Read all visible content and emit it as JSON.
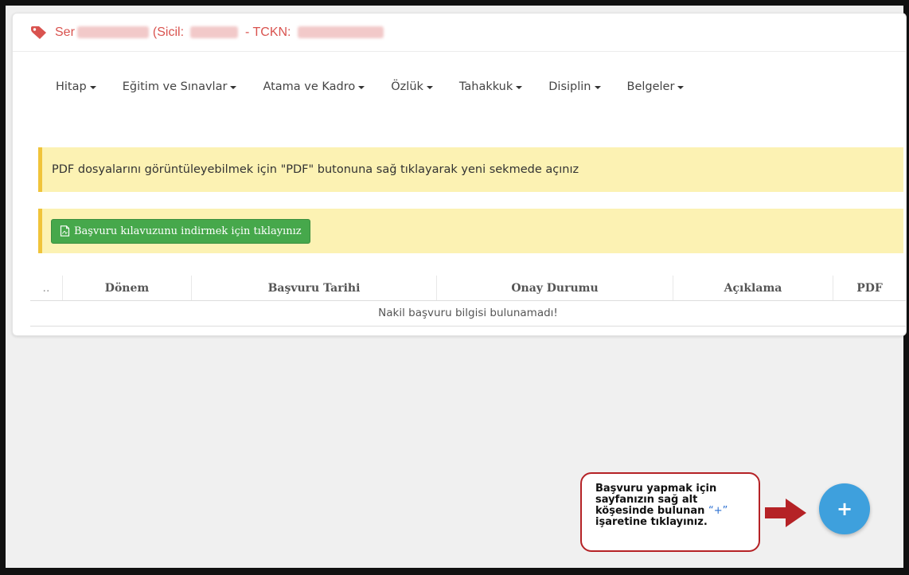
{
  "header": {
    "name_prefix": "Ser",
    "sicil_label": "(Sicil:",
    "tckn_label": "- TCKN:"
  },
  "nav": {
    "items": [
      {
        "label": "Hitap"
      },
      {
        "label": "Eğitim ve Sınavlar"
      },
      {
        "label": "Atama ve Kadro"
      },
      {
        "label": "Özlük"
      },
      {
        "label": "Tahakkuk"
      },
      {
        "label": "Disiplin"
      },
      {
        "label": "Belgeler"
      }
    ]
  },
  "alerts": {
    "pdf_notice": "PDF dosyalarını görüntüleyebilmek için \"PDF\" butonuna sağ tıklayarak yeni sekmede açınız",
    "guide_button": "Başvuru kılavuzunu indirmek için tıklayınız"
  },
  "table": {
    "columns": [
      "..",
      "Dönem",
      "Başvuru Tarihi",
      "Onay Durumu",
      "Açıklama",
      "PDF"
    ],
    "empty_message": "Nakil başvuru bilgisi bulunamadı!"
  },
  "callout": {
    "line1": "Başvuru yapmak için",
    "line2": "sayfanızın sağ alt",
    "line3": "köşesinde bulunan",
    "plus_quote": "“+”",
    "line4": "işaretine tıklayınız."
  },
  "fab": {
    "label": "+"
  },
  "colors": {
    "accent_red": "#d9534f",
    "alert_bg": "#fcf2b3",
    "alert_border": "#f0c43a",
    "button_green": "#46a84b",
    "fab_blue": "#3ea0dd",
    "callout_border": "#b52226"
  },
  "icons": {
    "header": "tag-icon",
    "guide_button": "pdf-file-icon",
    "arrow": "arrow-right-icon",
    "caret": "caret-down-icon"
  }
}
